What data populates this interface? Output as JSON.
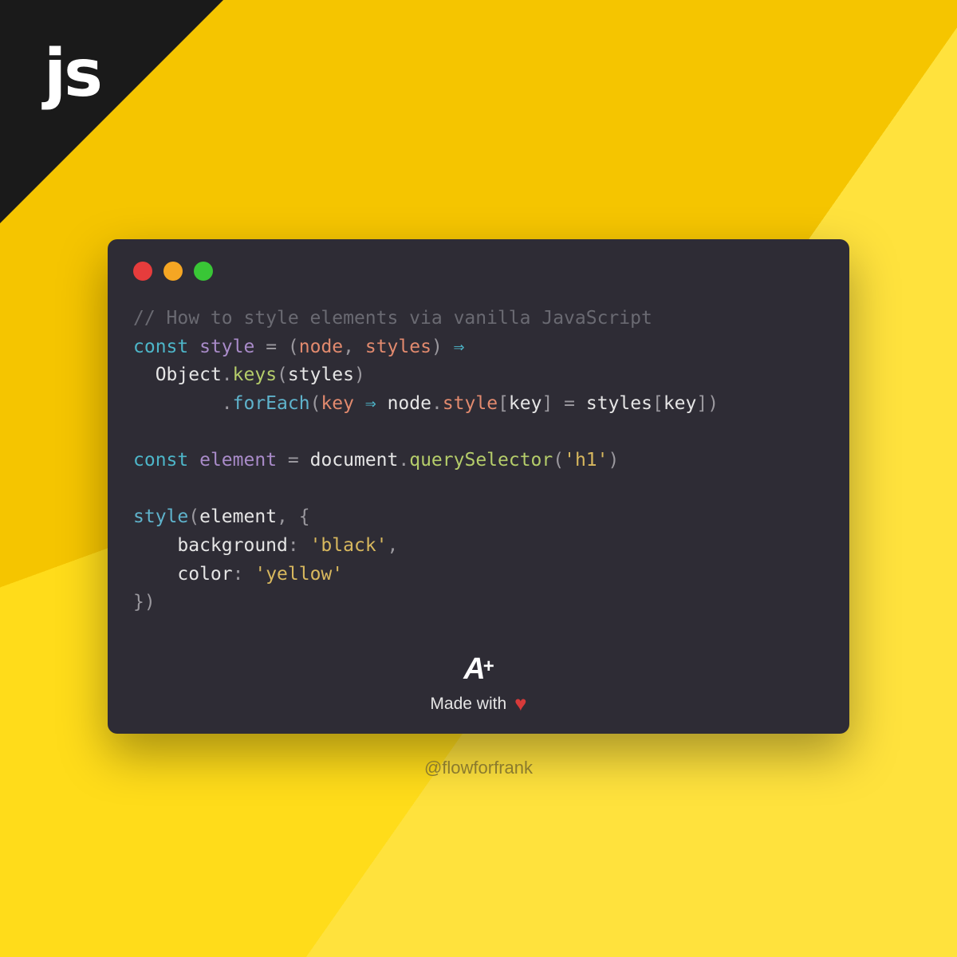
{
  "corner": {
    "label": "js"
  },
  "code": {
    "comment": "// How to style elements via vanilla JavaScript",
    "line1": {
      "const": "const",
      "style": "style",
      "eq": " = (",
      "node": "node",
      "comma": ", ",
      "styles": "styles",
      "close": ") ",
      "arrow": "⇒"
    },
    "line2": {
      "indent": "  ",
      "Object": "Object",
      "dot": ".",
      "keys": "keys",
      "open": "(",
      "styles": "styles",
      "close": ")"
    },
    "line3": {
      "indent": "        ",
      "dot": ".",
      "forEach": "forEach",
      "open": "(",
      "key": "key",
      "sp": " ",
      "arrow": "⇒",
      "sp2": " ",
      "node": "node",
      "dot2": ".",
      "styleProp": "style",
      "br1": "[",
      "key2": "key",
      "br2": "]",
      "eq": " = ",
      "styles": "styles",
      "br3": "[",
      "key3": "key",
      "br4": "])"
    },
    "line5": {
      "const": "const",
      "element": "element",
      "eq": " = ",
      "document": "document",
      "dot": ".",
      "querySelector": "querySelector",
      "open": "(",
      "h1": "'h1'",
      "close": ")"
    },
    "line7": {
      "style": "style",
      "open": "(",
      "element": "element",
      "comma": ", {"
    },
    "line8": {
      "indent": "    ",
      "background": "background",
      "colon": ": ",
      "black": "'black'",
      "comma": ","
    },
    "line9": {
      "indent": "    ",
      "color": "color",
      "colon": ": ",
      "yellow": "'yellow'"
    },
    "line10": {
      "close": "})"
    }
  },
  "footer": {
    "logoA": "A",
    "logoPlus": "+",
    "madeWith": "Made with",
    "heart": "♥"
  },
  "attribution": "@flowforfrank"
}
